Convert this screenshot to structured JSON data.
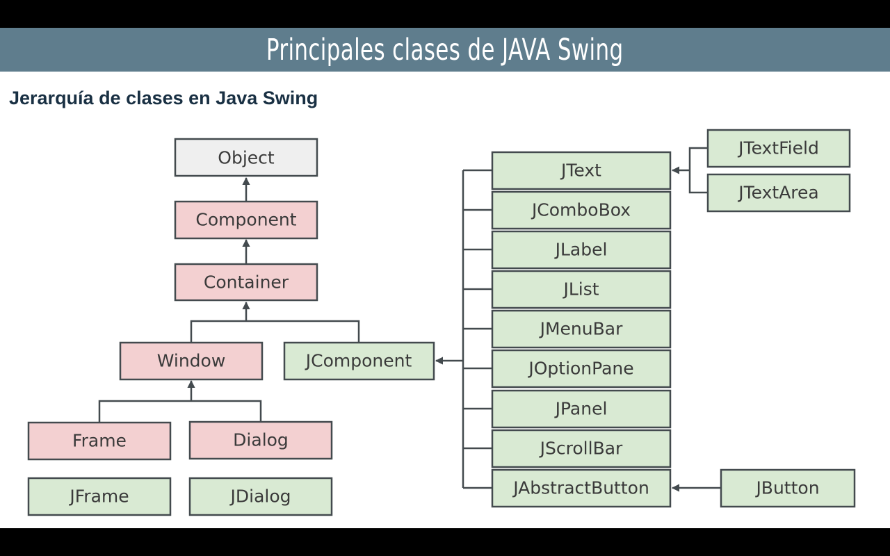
{
  "slide": {
    "title": "Principales clases de JAVA Swing",
    "subtitle": "Jerarquía de clases en Java Swing"
  },
  "colors": {
    "banner": "#5f7d8d",
    "awt_fill": "#f3d0d1",
    "swing_fill": "#d9ead3",
    "root_fill": "#efefef",
    "border": "#434a4e"
  },
  "diagram": {
    "classes": {
      "object": "Object",
      "component": "Component",
      "container": "Container",
      "window": "Window",
      "jcomponent": "JComponent",
      "frame": "Frame",
      "dialog": "Dialog",
      "jframe": "JFrame",
      "jdialog": "JDialog",
      "jtext": "JText",
      "jcombobox": "JComboBox",
      "jlabel": "JLabel",
      "jlist": "JList",
      "jmenubar": "JMenuBar",
      "joptionpane": "JOptionPane",
      "jpanel": "JPanel",
      "jscrollbar": "JScrollBar",
      "jabstractbutton": "JAbstractButton",
      "jtextfield": "JTextField",
      "jtextarea": "JTextArea",
      "jbutton": "JButton"
    }
  }
}
